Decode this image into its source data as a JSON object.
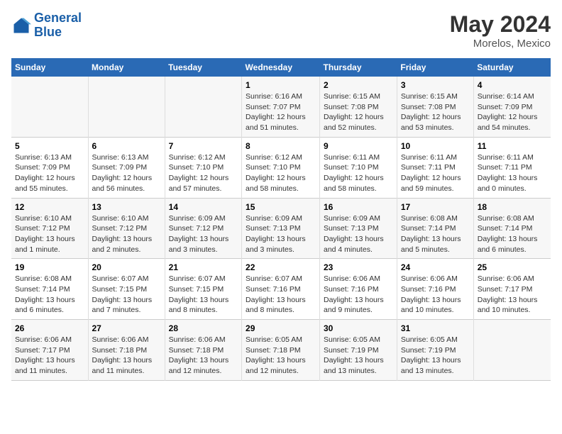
{
  "header": {
    "logo_line1": "General",
    "logo_line2": "Blue",
    "month": "May 2024",
    "location": "Morelos, Mexico"
  },
  "weekdays": [
    "Sunday",
    "Monday",
    "Tuesday",
    "Wednesday",
    "Thursday",
    "Friday",
    "Saturday"
  ],
  "weeks": [
    [
      {
        "day": "",
        "info": ""
      },
      {
        "day": "",
        "info": ""
      },
      {
        "day": "",
        "info": ""
      },
      {
        "day": "1",
        "info": "Sunrise: 6:16 AM\nSunset: 7:07 PM\nDaylight: 12 hours\nand 51 minutes."
      },
      {
        "day": "2",
        "info": "Sunrise: 6:15 AM\nSunset: 7:08 PM\nDaylight: 12 hours\nand 52 minutes."
      },
      {
        "day": "3",
        "info": "Sunrise: 6:15 AM\nSunset: 7:08 PM\nDaylight: 12 hours\nand 53 minutes."
      },
      {
        "day": "4",
        "info": "Sunrise: 6:14 AM\nSunset: 7:09 PM\nDaylight: 12 hours\nand 54 minutes."
      }
    ],
    [
      {
        "day": "5",
        "info": "Sunrise: 6:13 AM\nSunset: 7:09 PM\nDaylight: 12 hours\nand 55 minutes."
      },
      {
        "day": "6",
        "info": "Sunrise: 6:13 AM\nSunset: 7:09 PM\nDaylight: 12 hours\nand 56 minutes."
      },
      {
        "day": "7",
        "info": "Sunrise: 6:12 AM\nSunset: 7:10 PM\nDaylight: 12 hours\nand 57 minutes."
      },
      {
        "day": "8",
        "info": "Sunrise: 6:12 AM\nSunset: 7:10 PM\nDaylight: 12 hours\nand 58 minutes."
      },
      {
        "day": "9",
        "info": "Sunrise: 6:11 AM\nSunset: 7:10 PM\nDaylight: 12 hours\nand 58 minutes."
      },
      {
        "day": "10",
        "info": "Sunrise: 6:11 AM\nSunset: 7:11 PM\nDaylight: 12 hours\nand 59 minutes."
      },
      {
        "day": "11",
        "info": "Sunrise: 6:11 AM\nSunset: 7:11 PM\nDaylight: 13 hours\nand 0 minutes."
      }
    ],
    [
      {
        "day": "12",
        "info": "Sunrise: 6:10 AM\nSunset: 7:12 PM\nDaylight: 13 hours\nand 1 minute."
      },
      {
        "day": "13",
        "info": "Sunrise: 6:10 AM\nSunset: 7:12 PM\nDaylight: 13 hours\nand 2 minutes."
      },
      {
        "day": "14",
        "info": "Sunrise: 6:09 AM\nSunset: 7:12 PM\nDaylight: 13 hours\nand 3 minutes."
      },
      {
        "day": "15",
        "info": "Sunrise: 6:09 AM\nSunset: 7:13 PM\nDaylight: 13 hours\nand 3 minutes."
      },
      {
        "day": "16",
        "info": "Sunrise: 6:09 AM\nSunset: 7:13 PM\nDaylight: 13 hours\nand 4 minutes."
      },
      {
        "day": "17",
        "info": "Sunrise: 6:08 AM\nSunset: 7:14 PM\nDaylight: 13 hours\nand 5 minutes."
      },
      {
        "day": "18",
        "info": "Sunrise: 6:08 AM\nSunset: 7:14 PM\nDaylight: 13 hours\nand 6 minutes."
      }
    ],
    [
      {
        "day": "19",
        "info": "Sunrise: 6:08 AM\nSunset: 7:14 PM\nDaylight: 13 hours\nand 6 minutes."
      },
      {
        "day": "20",
        "info": "Sunrise: 6:07 AM\nSunset: 7:15 PM\nDaylight: 13 hours\nand 7 minutes."
      },
      {
        "day": "21",
        "info": "Sunrise: 6:07 AM\nSunset: 7:15 PM\nDaylight: 13 hours\nand 8 minutes."
      },
      {
        "day": "22",
        "info": "Sunrise: 6:07 AM\nSunset: 7:16 PM\nDaylight: 13 hours\nand 8 minutes."
      },
      {
        "day": "23",
        "info": "Sunrise: 6:06 AM\nSunset: 7:16 PM\nDaylight: 13 hours\nand 9 minutes."
      },
      {
        "day": "24",
        "info": "Sunrise: 6:06 AM\nSunset: 7:16 PM\nDaylight: 13 hours\nand 10 minutes."
      },
      {
        "day": "25",
        "info": "Sunrise: 6:06 AM\nSunset: 7:17 PM\nDaylight: 13 hours\nand 10 minutes."
      }
    ],
    [
      {
        "day": "26",
        "info": "Sunrise: 6:06 AM\nSunset: 7:17 PM\nDaylight: 13 hours\nand 11 minutes."
      },
      {
        "day": "27",
        "info": "Sunrise: 6:06 AM\nSunset: 7:18 PM\nDaylight: 13 hours\nand 11 minutes."
      },
      {
        "day": "28",
        "info": "Sunrise: 6:06 AM\nSunset: 7:18 PM\nDaylight: 13 hours\nand 12 minutes."
      },
      {
        "day": "29",
        "info": "Sunrise: 6:05 AM\nSunset: 7:18 PM\nDaylight: 13 hours\nand 12 minutes."
      },
      {
        "day": "30",
        "info": "Sunrise: 6:05 AM\nSunset: 7:19 PM\nDaylight: 13 hours\nand 13 minutes."
      },
      {
        "day": "31",
        "info": "Sunrise: 6:05 AM\nSunset: 7:19 PM\nDaylight: 13 hours\nand 13 minutes."
      },
      {
        "day": "",
        "info": ""
      }
    ]
  ]
}
